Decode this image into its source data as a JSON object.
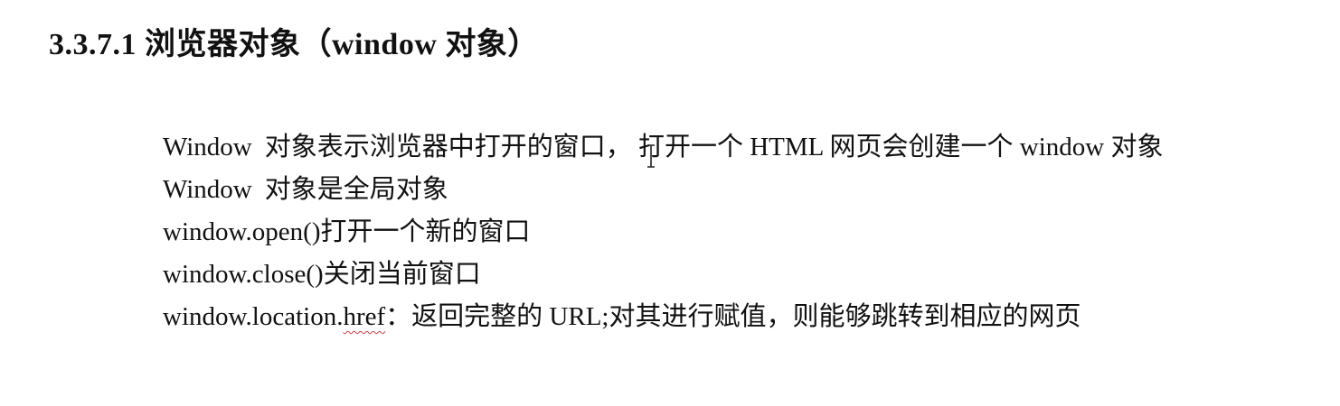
{
  "heading": "3.3.7.1 浏览器对象（window 对象）",
  "lines": [
    {
      "part1": "Window",
      "part2": "对象表示浏览器中打开的窗口，  打开一个 HTML 网页会创建一个 window 对象"
    },
    {
      "part1": "Window",
      "part2": "对象是全局对象"
    },
    {
      "text": "window.open()打开一个新的窗口"
    },
    {
      "text": "window.close()关闭当前窗口"
    },
    {
      "prefix": "window.location.",
      "squiggle": "href",
      "suffix": "：返回完整的 URL;对其进行赋值，则能够跳转到相应的网页"
    }
  ]
}
